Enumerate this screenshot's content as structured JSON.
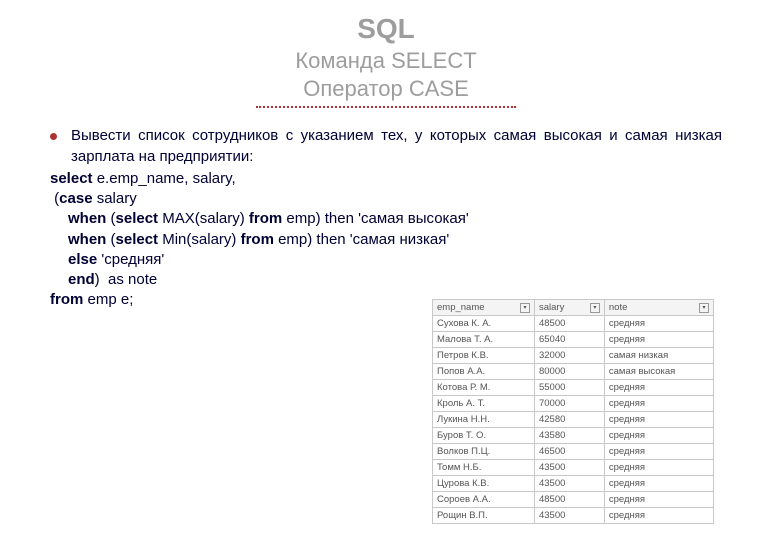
{
  "title": "SQL",
  "subtitle1": "Команда SELECT",
  "subtitle2": "Оператор CASE",
  "bullet": "Вывести список сотрудников с указанием тех, у которых самая высокая и самая низкая зарплата на предприятии:",
  "code": {
    "l1a": "select",
    "l1b": " e.emp_name, salary,",
    "l2a": " (",
    "l2b": "case",
    "l2c": " salary",
    "l3a": "when",
    "l3b": " (",
    "l3c": "select",
    "l3d": " MAX(salary) ",
    "l3e": "from",
    "l3f": " emp) then 'самая высокая'",
    "l4a": "when",
    "l4b": " (",
    "l4c": "select",
    "l4d": " Min(salary) ",
    "l4e": "from",
    "l4f": " emp) then 'самая низкая'",
    "l5a": "else",
    "l5b": " 'средняя'",
    "l6a": "end",
    "l6b": ")  as note",
    "l7a": "from",
    "l7b": " emp e;"
  },
  "table": {
    "headers": [
      "emp_name",
      "salary",
      "note"
    ],
    "rows": [
      [
        "Сухова К. А.",
        "48500",
        "средняя"
      ],
      [
        "Малова Т. А.",
        "65040",
        "средняя"
      ],
      [
        "Петров К.В.",
        "32000",
        "самая низкая"
      ],
      [
        "Попов А.А.",
        "80000",
        "самая высокая"
      ],
      [
        "Котова Р. М.",
        "55000",
        "средняя"
      ],
      [
        "Кроль А. Т.",
        "70000",
        "средняя"
      ],
      [
        "Лукина Н.Н.",
        "42580",
        "средняя"
      ],
      [
        "Буров Т. О.",
        "43580",
        "средняя"
      ],
      [
        "Волков П.Ц.",
        "46500",
        "средняя"
      ],
      [
        "Томм Н.Б.",
        "43500",
        "средняя"
      ],
      [
        "Цурова К.В.",
        "43500",
        "средняя"
      ],
      [
        "Сороев А.А.",
        "48500",
        "средняя"
      ],
      [
        "Рощин В.П.",
        "43500",
        "средняя"
      ]
    ]
  }
}
